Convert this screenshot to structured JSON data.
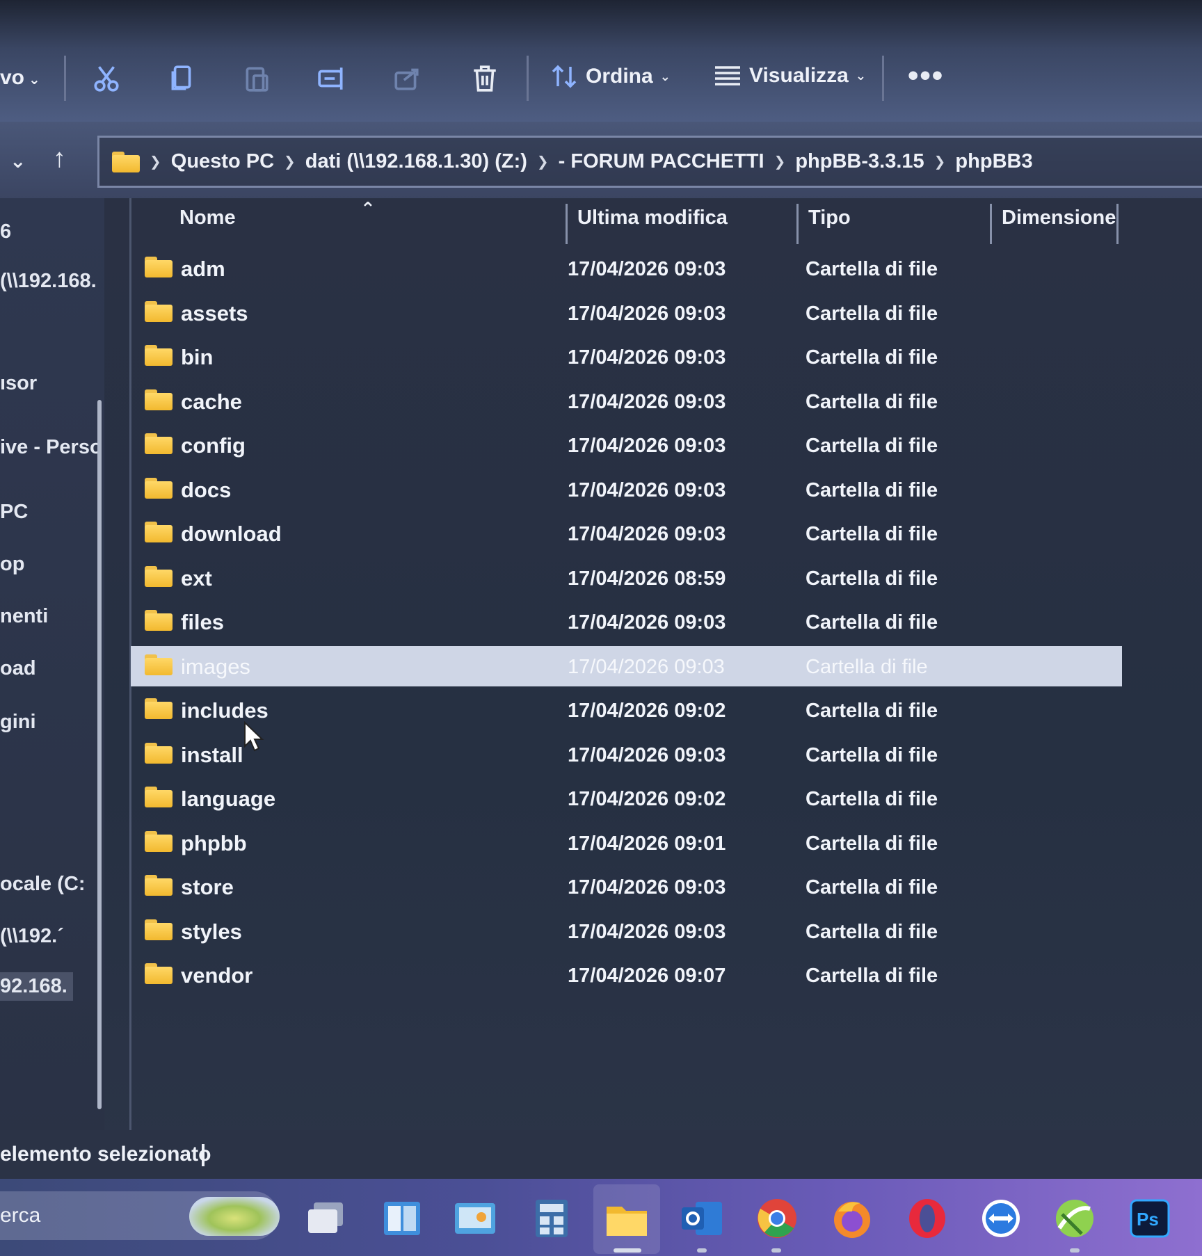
{
  "toolbar": {
    "new_label": "vo",
    "sort_label": "Ordina",
    "view_label": "Visualizza",
    "more_label": "•••"
  },
  "address": {
    "crumbs": [
      "Questo PC",
      "dati (\\\\192.168.1.30) (Z:)",
      "- FORUM PACCHETTI",
      "phpBB-3.3.15",
      "phpBB3"
    ]
  },
  "sidebar": {
    "items": [
      {
        "label": "6"
      },
      {
        "label": "(\\\\192.168."
      },
      {
        "label": "ısor"
      },
      {
        "label": "ive - Perso"
      },
      {
        "label": "PC"
      },
      {
        "label": "op"
      },
      {
        "label": "nenti"
      },
      {
        "label": "oad"
      },
      {
        "label": "gini"
      },
      {
        "label": "ocale (C:"
      },
      {
        "label": "(\\\\192.´"
      },
      {
        "label": "92.168."
      }
    ]
  },
  "columns": {
    "name": "Nome",
    "modified": "Ultima modifica",
    "type": "Tipo",
    "size": "Dimensione"
  },
  "files": [
    {
      "name": "adm",
      "modified": "17/04/2026 09:03",
      "type": "Cartella di file"
    },
    {
      "name": "assets",
      "modified": "17/04/2026 09:03",
      "type": "Cartella di file"
    },
    {
      "name": "bin",
      "modified": "17/04/2026 09:03",
      "type": "Cartella di file"
    },
    {
      "name": "cache",
      "modified": "17/04/2026 09:03",
      "type": "Cartella di file"
    },
    {
      "name": "config",
      "modified": "17/04/2026 09:03",
      "type": "Cartella di file"
    },
    {
      "name": "docs",
      "modified": "17/04/2026 09:03",
      "type": "Cartella di file"
    },
    {
      "name": "download",
      "modified": "17/04/2026 09:03",
      "type": "Cartella di file"
    },
    {
      "name": "ext",
      "modified": "17/04/2026 08:59",
      "type": "Cartella di file"
    },
    {
      "name": "files",
      "modified": "17/04/2026 09:03",
      "type": "Cartella di file"
    },
    {
      "name": "images",
      "modified": "17/04/2026 09:03",
      "type": "Cartella di file",
      "selected": true
    },
    {
      "name": "includes",
      "modified": "17/04/2026 09:02",
      "type": "Cartella di file"
    },
    {
      "name": "install",
      "modified": "17/04/2026 09:03",
      "type": "Cartella di file"
    },
    {
      "name": "language",
      "modified": "17/04/2026 09:02",
      "type": "Cartella di file"
    },
    {
      "name": "phpbb",
      "modified": "17/04/2026 09:01",
      "type": "Cartella di file"
    },
    {
      "name": "store",
      "modified": "17/04/2026 09:03",
      "type": "Cartella di file"
    },
    {
      "name": "styles",
      "modified": "17/04/2026 09:03",
      "type": "Cartella di file"
    },
    {
      "name": "vendor",
      "modified": "17/04/2026 09:07",
      "type": "Cartella di file"
    }
  ],
  "status": {
    "text": "elemento selezionato"
  },
  "taskbar": {
    "search_text": "erca",
    "apps": [
      "task-view-icon",
      "widgets-icon",
      "control-panel-icon",
      "calculator-icon",
      "file-explorer-icon",
      "outlook-icon",
      "chrome-icon",
      "firefox-icon",
      "opera-icon",
      "teamviewer-icon",
      "maps-icon",
      "photoshop-icon"
    ]
  },
  "colors": {
    "selection": "#cfd6e6",
    "folder": "#f2b92f",
    "background": "#263042"
  }
}
